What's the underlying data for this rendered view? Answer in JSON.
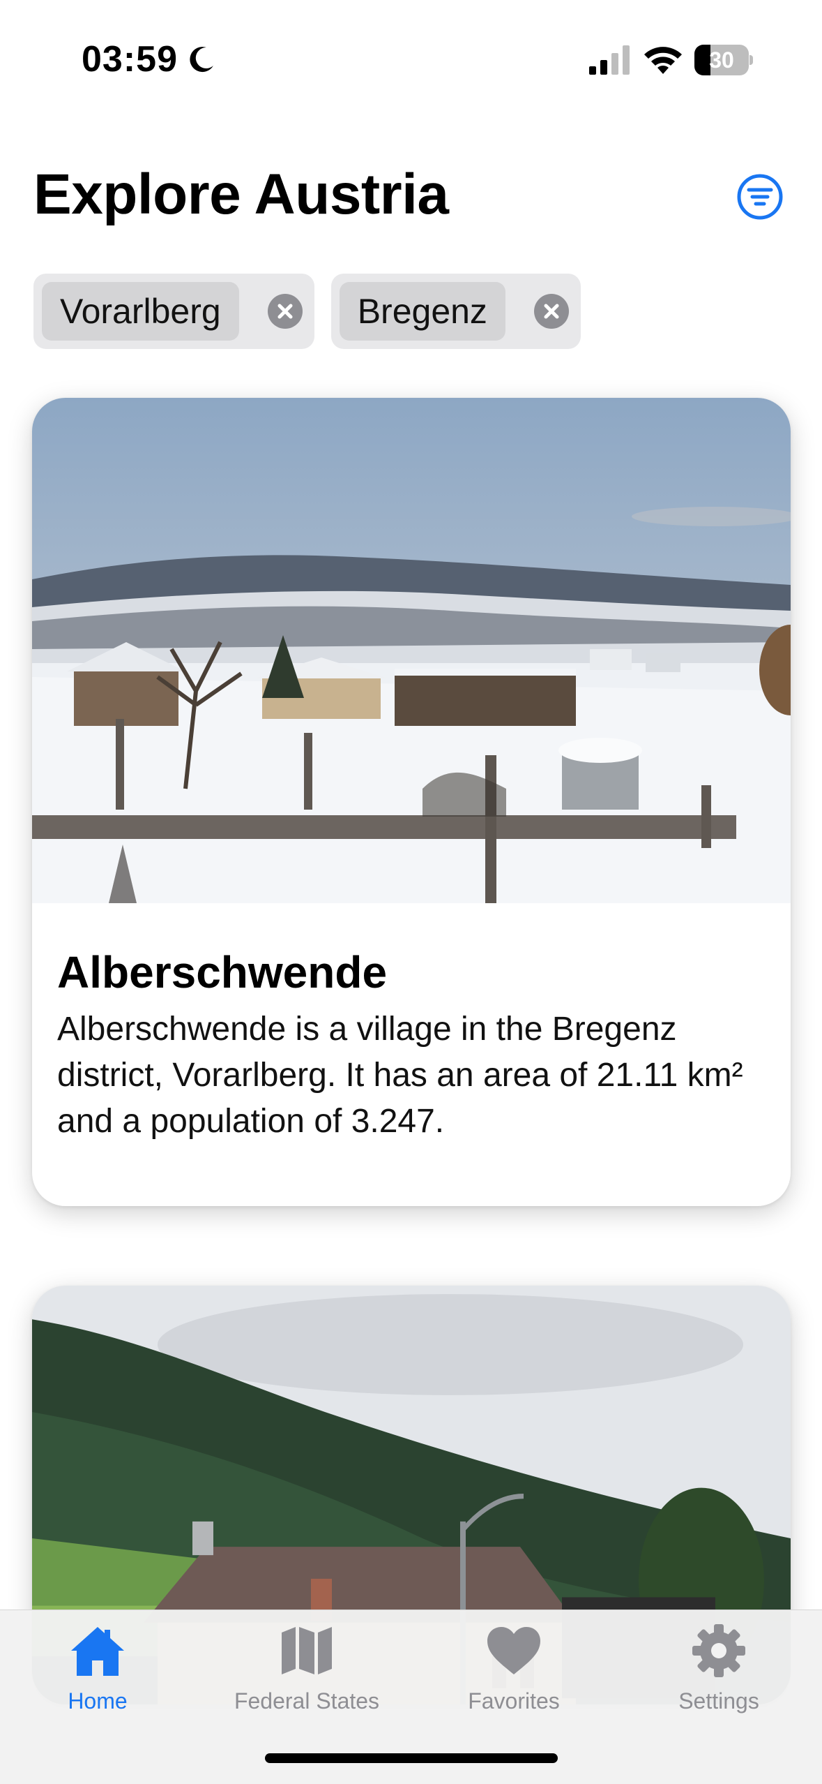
{
  "status_bar": {
    "time": "03:59",
    "battery_level": "30",
    "battery_fraction": 0.3
  },
  "header": {
    "title": "Explore Austria",
    "filter_icon": "filter-circle-icon"
  },
  "filters": {
    "chips": [
      {
        "label": "Vorarlberg"
      },
      {
        "label": "Bregenz"
      }
    ]
  },
  "cards": [
    {
      "title": "Alberschwende",
      "description": "Alberschwende is a village in the Bregenz district, Vorarlberg. It has an area of 21.11 km² and a population of 3.247."
    }
  ],
  "tab_bar": {
    "tabs": [
      {
        "label": "Home",
        "icon": "house-icon",
        "active": true
      },
      {
        "label": "Federal States",
        "icon": "map-icon",
        "active": false
      },
      {
        "label": "Favorites",
        "icon": "heart-icon",
        "active": false
      },
      {
        "label": "Settings",
        "icon": "gear-icon",
        "active": false
      }
    ]
  },
  "colors": {
    "accent": "#1976f2",
    "inactive": "#8e8e93"
  }
}
